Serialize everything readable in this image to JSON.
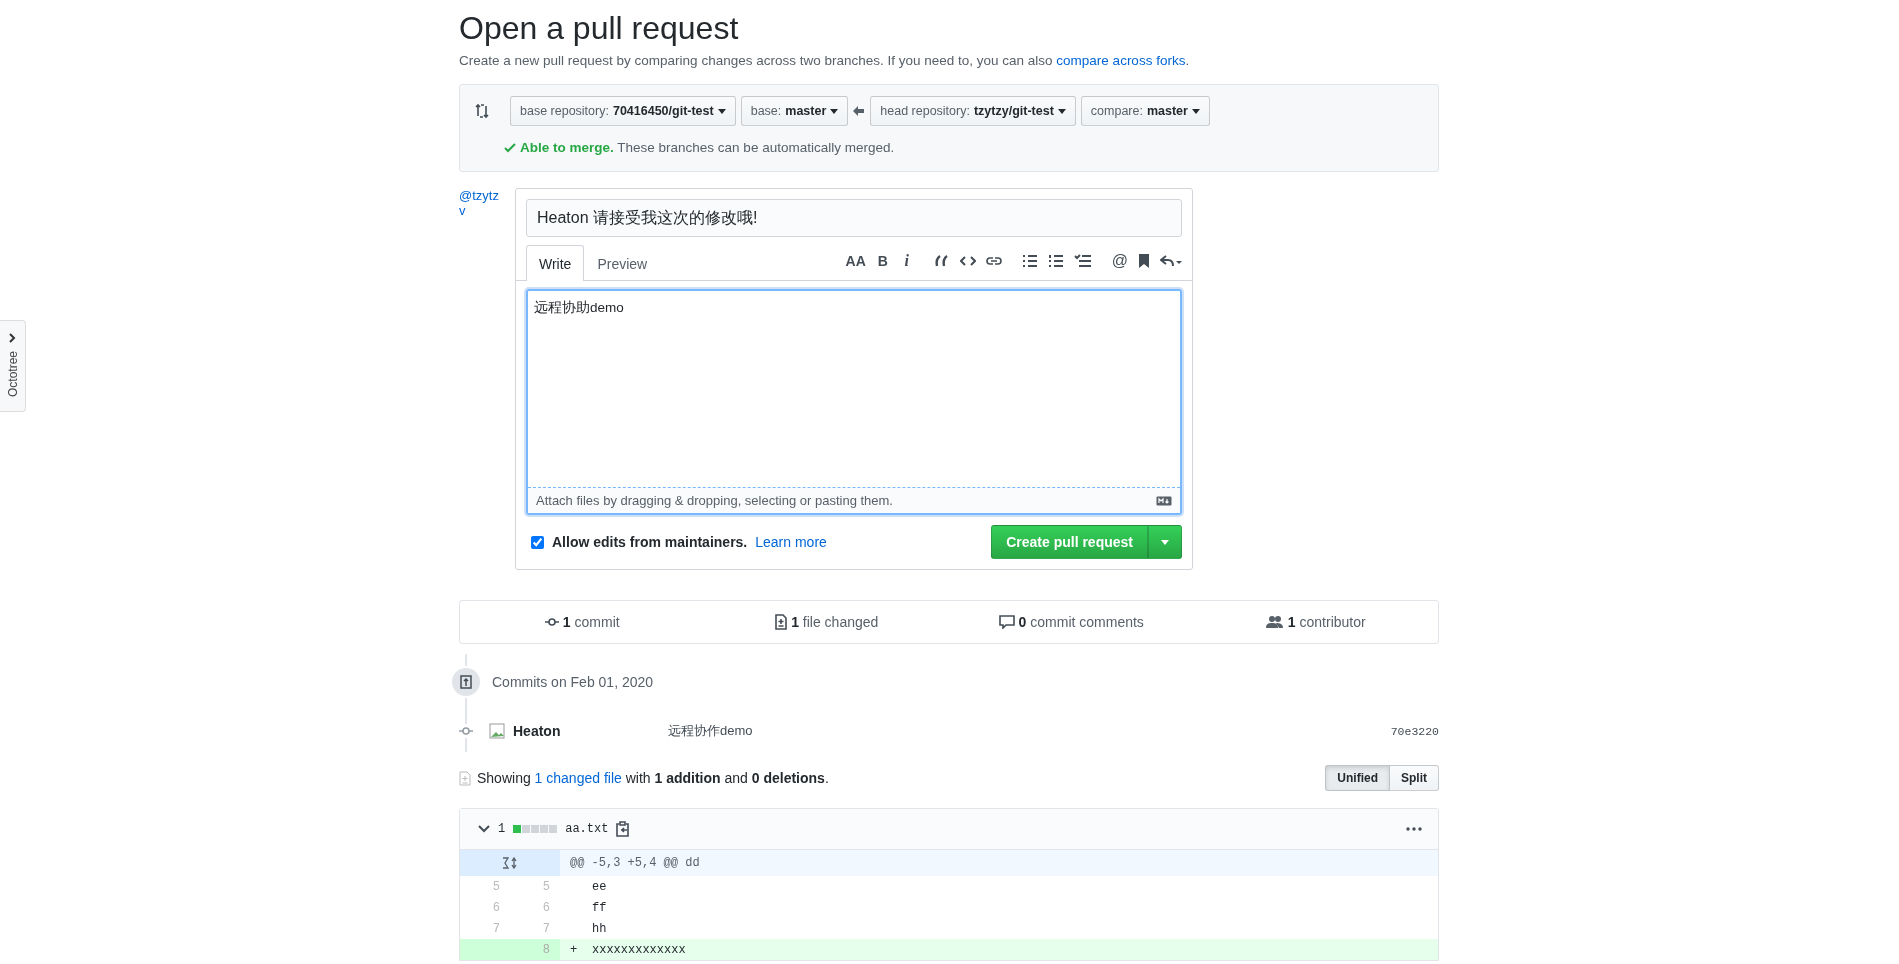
{
  "sidebar_tab": {
    "label": "Octotree"
  },
  "page_title": "Open a pull request",
  "subtitle": {
    "text": "Create a new pull request by comparing changes across two branches. If you need to, you can also ",
    "link": "compare across forks",
    "end": "."
  },
  "compare": {
    "selectors": [
      {
        "label": "base repository:",
        "value": "70416450/git-test"
      },
      {
        "label": "base:",
        "value": "master"
      },
      {
        "label": "head repository:",
        "value": "tzytzy/git-test"
      },
      {
        "label": "compare:",
        "value": "master"
      }
    ],
    "merge_status": {
      "status": "Able to merge.",
      "message": "These branches can be automatically merged."
    }
  },
  "avatar": {
    "alt_text": "@tzytzv"
  },
  "pr_form": {
    "title_value": "Heaton 请接受我这次的修改哦!",
    "tabs": [
      {
        "label": "Write",
        "selected": true
      },
      {
        "label": "Preview",
        "selected": false
      }
    ],
    "toolbar_glyphs": [
      "AA",
      "B",
      "i",
      "@"
    ],
    "body_value": "远程协助demo",
    "attach_hint": "Attach files by dragging & dropping, selecting or pasting them.",
    "allow_edits": {
      "checked": true,
      "label": "Allow edits from maintainers.",
      "link": "Learn more"
    },
    "submit": "Create pull request"
  },
  "stats": [
    {
      "kind": "commit",
      "count": "1",
      "label": "commit"
    },
    {
      "kind": "file",
      "count": "1",
      "label": "file changed"
    },
    {
      "kind": "comment",
      "count": "0",
      "label": "commit comments"
    },
    {
      "kind": "people",
      "count": "1",
      "label": "contributor"
    }
  ],
  "commits": {
    "date_heading": "Commits on Feb 01, 2020",
    "items": [
      {
        "author": "Heaton",
        "message": "远程协作demo",
        "sha": "70e3220"
      }
    ]
  },
  "diff_summary": {
    "prefix": "Showing ",
    "link": "1 changed file",
    "rest": " with **1 addition** and **0 deletions**."
  },
  "view_toggle": [
    {
      "label": "Unified",
      "selected": true
    },
    {
      "label": "Split",
      "selected": false
    }
  ],
  "file": {
    "count": "1",
    "diffstat": [
      {
        "kind": "added"
      },
      {
        "kind": "neutral"
      },
      {
        "kind": "neutral"
      },
      {
        "kind": "neutral"
      },
      {
        "kind": "neutral"
      }
    ],
    "name": "aa.txt",
    "hunk": "@@ -5,3 +5,4 @@ dd",
    "lines": [
      {
        "kind": "context",
        "old": "5",
        "new": "5",
        "code": "ee"
      },
      {
        "kind": "context",
        "old": "6",
        "new": "6",
        "code": "ff"
      },
      {
        "kind": "context",
        "old": "7",
        "new": "7",
        "code": "hh"
      },
      {
        "kind": "addition",
        "new": "8",
        "marker": "+",
        "code": "xxxxxxxxxxxxx"
      }
    ]
  }
}
